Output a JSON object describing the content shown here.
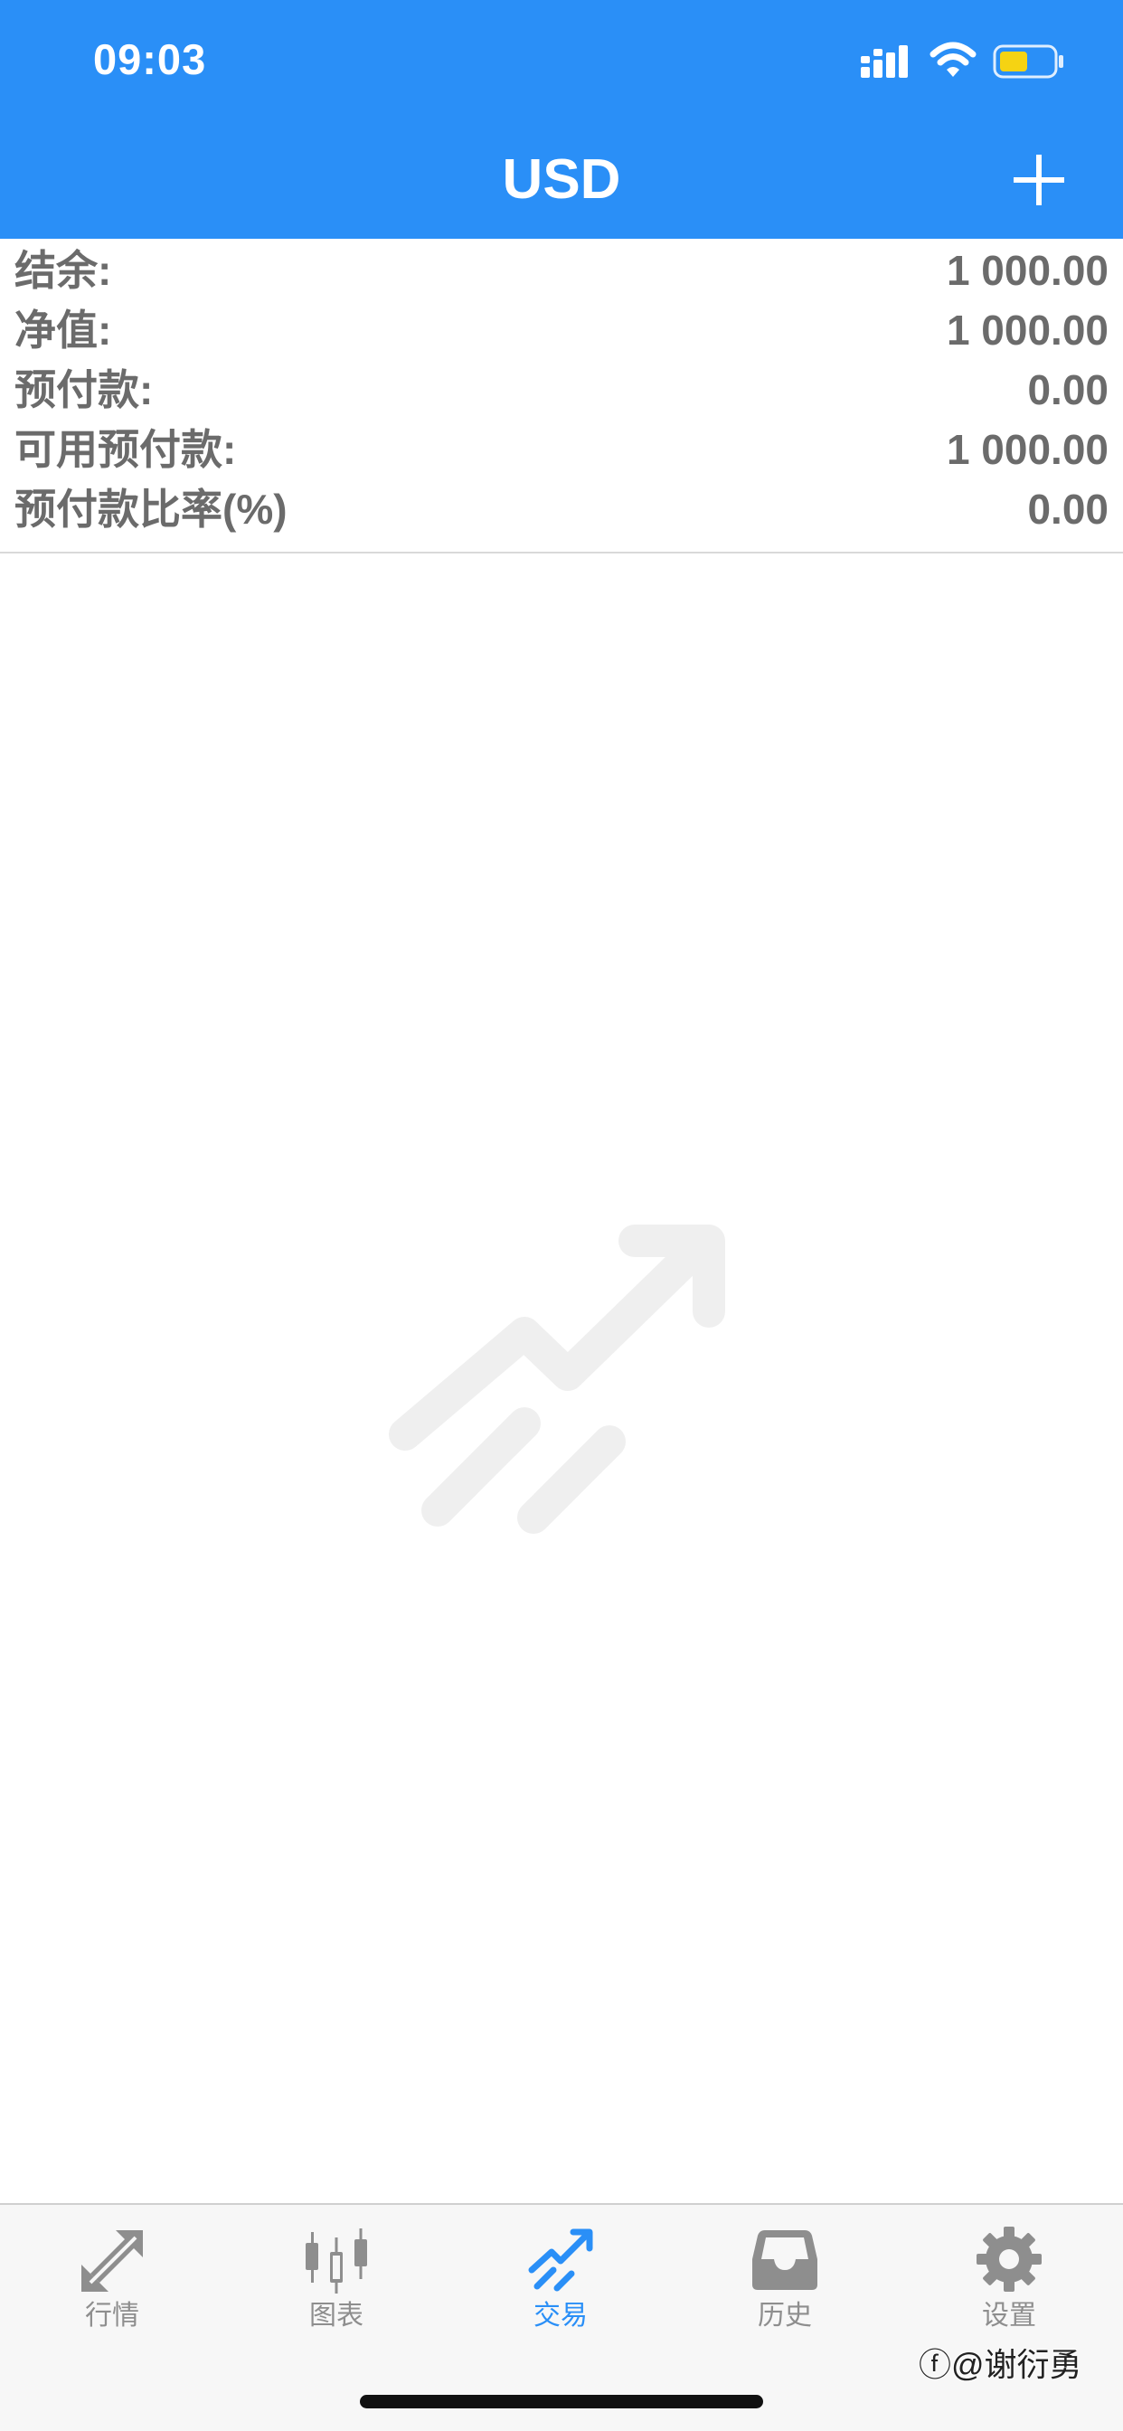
{
  "status_bar": {
    "time": "09:03"
  },
  "header": {
    "title": "USD",
    "add_icon": "plus-icon"
  },
  "account_summary": [
    {
      "label": "结余:",
      "value": "1 000.00"
    },
    {
      "label": "净值:",
      "value": "1 000.00"
    },
    {
      "label": "预付款:",
      "value": "0.00"
    },
    {
      "label": "可用预付款:",
      "value": "1 000.00"
    },
    {
      "label": "预付款比率(%)",
      "value": "0.00"
    }
  ],
  "empty_state": {
    "icon": "trade-chart-icon"
  },
  "tabs": [
    {
      "label": "行情",
      "icon": "quotes-icon",
      "active": false
    },
    {
      "label": "图表",
      "icon": "candlestick-chart-icon",
      "active": false
    },
    {
      "label": "交易",
      "icon": "trade-icon",
      "active": true
    },
    {
      "label": "历史",
      "icon": "history-inbox-icon",
      "active": false
    },
    {
      "label": "设置",
      "icon": "settings-gear-icon",
      "active": false
    }
  ],
  "watermark": "ⓕ@谢衍勇",
  "colors": {
    "header_bg": "#2a8ff7",
    "accent": "#2a8ff7",
    "text_gray": "#6b6b6b",
    "tab_inactive": "#8e8e8e",
    "battery_fill": "#f5d313"
  }
}
